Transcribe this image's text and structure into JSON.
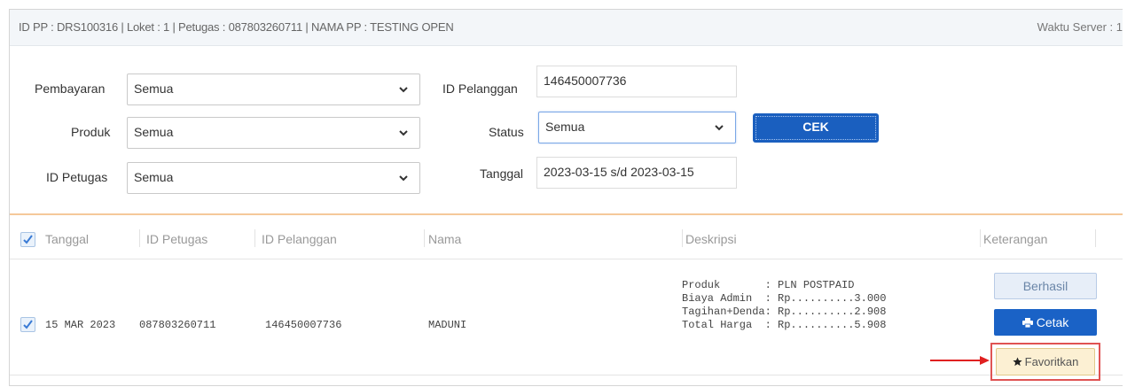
{
  "info_bar": {
    "text": "ID PP : DRS100316 | Loket : 1 | Petugas : 087803260711 | NAMA PP : TESTING OPEN",
    "server_time": "Waktu Server : 1"
  },
  "filters": {
    "pembayaran": {
      "label": "Pembayaran",
      "value": "Semua"
    },
    "produk": {
      "label": "Produk",
      "value": "Semua"
    },
    "id_petugas": {
      "label": "ID Petugas",
      "value": "Semua"
    },
    "id_pelanggan": {
      "label": "ID Pelanggan",
      "value": "146450007736"
    },
    "status": {
      "label": "Status",
      "value": "Semua"
    },
    "tanggal": {
      "label": "Tanggal",
      "value": "2023-03-15 s/d 2023-03-15"
    },
    "cek_label": "CEK"
  },
  "table": {
    "columns": [
      "Tanggal",
      "ID Petugas",
      "ID Pelanggan",
      "Nama",
      "Deskripsi",
      "Keterangan"
    ],
    "rows": [
      {
        "tanggal": "15 MAR 2023",
        "id_petugas": "087803260711",
        "id_pelanggan": "146450007736",
        "nama": "MADUNI",
        "deskripsi": "Produk       : PLN POSTPAID\nBiaya Admin  : Rp..........3.000\nTagihan+Denda: Rp..........2.908\nTotal Harga  : Rp..........5.908",
        "status_label": "Berhasil",
        "cetak_label": "Cetak",
        "favorit_label": "Favoritkan",
        "checked": true
      }
    ]
  },
  "colors": {
    "primary_button": "#1a5fbf",
    "highlight_box": "#e05353",
    "annotation_arrow": "#e02020"
  },
  "icons": [
    "chevron-down-icon",
    "check-icon",
    "printer-icon",
    "star-icon",
    "arrow-right-icon"
  ]
}
